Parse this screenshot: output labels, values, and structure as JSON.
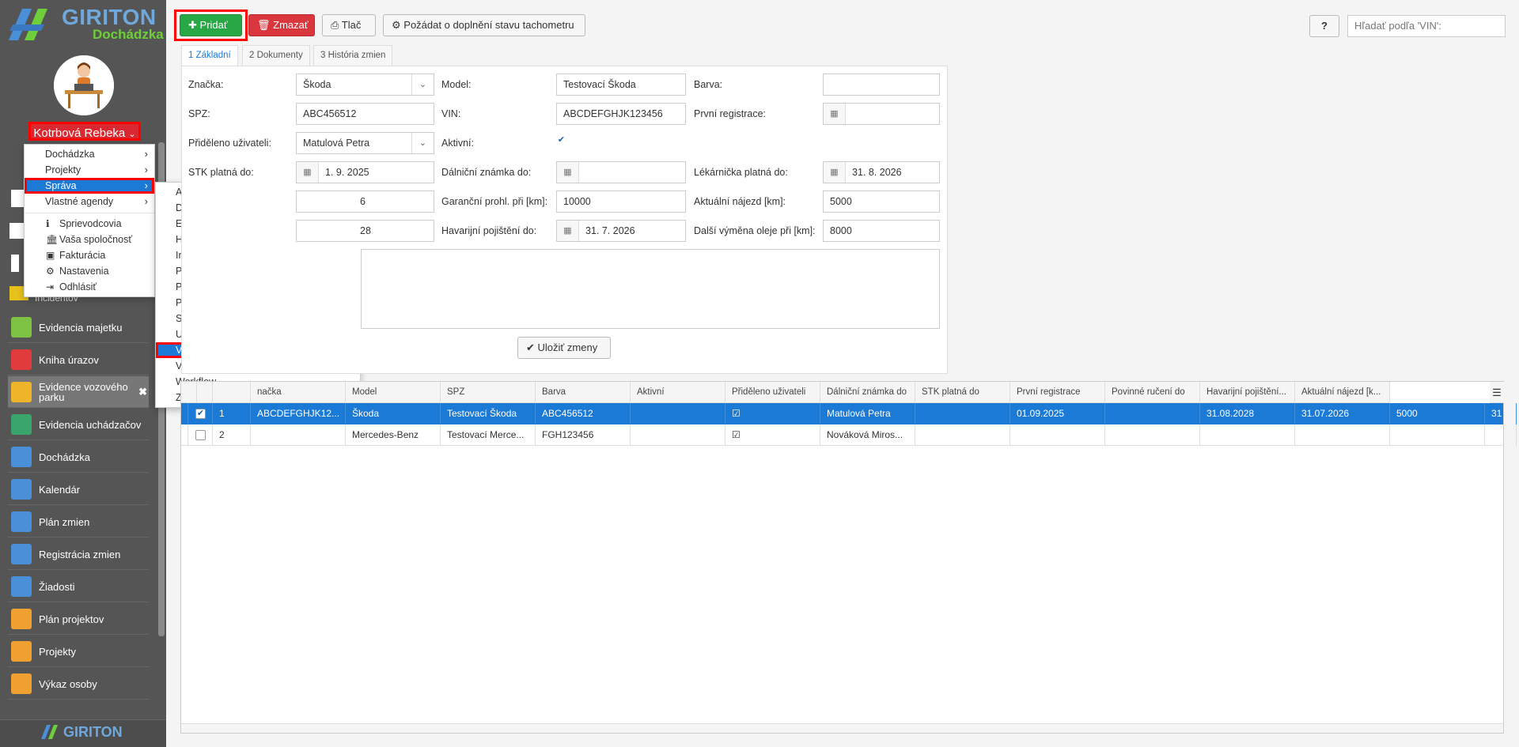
{
  "brand": {
    "name": "GIRITON",
    "product": "Dochádzka"
  },
  "user": {
    "name": "Kotrbová Rebeka"
  },
  "user_menu": {
    "items": [
      "Dochádzka",
      "Projekty",
      "Správa",
      "Vlastné agendy"
    ],
    "extra": [
      "Sprievodcovia",
      "Vaša spoločnosť",
      "Fakturácia",
      "Nastavenia",
      "Odhlásiť"
    ]
  },
  "sprava_menu": {
    "items": [
      "Akcie pri udalostiach na termináloch",
      "Dokumenty",
      "Externé kalendáre",
      "História",
      "Import dát",
      "Plánovanie alkohol testov",
      "Plánované úlohy",
      "Problémy s dátami užívateľov",
      "Skupiny oprávnení",
      "Upozornenie na termináloch",
      "Vlastné agendy",
      "Výsledky alkohol testov",
      "Workflow",
      "Zostavy"
    ]
  },
  "sidebar": {
    "partial_top": "Incidentov",
    "items": [
      "Evidencia majetku",
      "Kniha úrazov",
      "Evidence vozového parku",
      "Evidencia uchádzačov",
      "Dochádzka",
      "Kalendár",
      "Plán zmien",
      "Registrácia zmien",
      "Žiadosti",
      "Plán projektov",
      "Projekty",
      "Výkaz osoby"
    ]
  },
  "toolbar": {
    "add": "Pridať",
    "delete": "Zmazať",
    "print": "Tlač",
    "request": "Požádat o doplnění stavu tachometru",
    "help": "?",
    "search_placeholder": "Hľadať podľa 'VIN':"
  },
  "tabs": [
    "1 Základní",
    "2 Dokumenty",
    "3 História zmien"
  ],
  "form": {
    "labels": {
      "znacka": "Značka:",
      "model": "Model:",
      "barva": "Barva:",
      "spz": "SPZ:",
      "vin": "VIN:",
      "prvni_registrace": "První registrace:",
      "prideleno": "Přiděleno uživateli:",
      "aktivni": "Aktivní:",
      "stk": "STK platná do:",
      "dalnicni": "Dálniční známka do:",
      "lekarnicka": "Lékárnička platná do:",
      "garancni": "Garanční prohl. při [km]:",
      "najezd": "Aktuální nájezd [km]:",
      "havarijni": "Havarijní pojištění do:",
      "olej": "Další výměna oleje při [km]:"
    },
    "values": {
      "znacka": "Škoda",
      "model": "Testovací Škoda",
      "barva": "",
      "spz": "ABC456512",
      "vin": "ABCDEFGHJK123456",
      "prvni_registrace": "",
      "prideleno": "Matulová Petra",
      "aktivni": true,
      "stk": "1. 9. 2025",
      "dalnicni": "",
      "lekarnicka": "31. 8. 2026",
      "row5_left_partial": "6",
      "garancni": "10000",
      "najezd": "5000",
      "row6_left_partial": "28",
      "havarijni": "31. 7. 2026",
      "olej": "8000"
    },
    "save": "Uložiť zmeny"
  },
  "grid": {
    "columns": [
      "",
      "",
      "",
      "načka",
      "Model",
      "SPZ",
      "Barva",
      "Aktivní",
      "Přiděleno uživateli",
      "Dálniční známka do",
      "STK platná do",
      "První registrace",
      "Povinné ručení do",
      "Havarijní pojištění...",
      "Aktuální nájezd [k..."
    ],
    "rows": [
      {
        "selected": true,
        "checked": true,
        "id": "1",
        "vin": "ABCDEFGHJK12...",
        "znacka": "Škoda",
        "model": "Testovací Škoda",
        "spz": "ABC456512",
        "barva": "",
        "aktivni": true,
        "prideleno": "Matulová Petra",
        "dalnicni": "",
        "stk": "01.09.2025",
        "prvni": "",
        "povinne": "31.08.2028",
        "havarijni": "31.07.2026",
        "najezd": "5000",
        "extra": "31"
      },
      {
        "selected": false,
        "checked": false,
        "id": "2",
        "vin": "",
        "znacka": "Mercedes-Benz",
        "model": "Testovací Merce...",
        "spz": "FGH123456",
        "barva": "",
        "aktivni": true,
        "prideleno": "Nováková Miros...",
        "dalnicni": "",
        "stk": "",
        "prvni": "",
        "povinne": "",
        "havarijni": "",
        "najezd": "",
        "extra": ""
      }
    ]
  },
  "colors": {
    "accent": "#1a7ad6",
    "highlight": "#ff0000",
    "sidebar": "#555555",
    "green": "#28a745",
    "red": "#d9363e"
  }
}
